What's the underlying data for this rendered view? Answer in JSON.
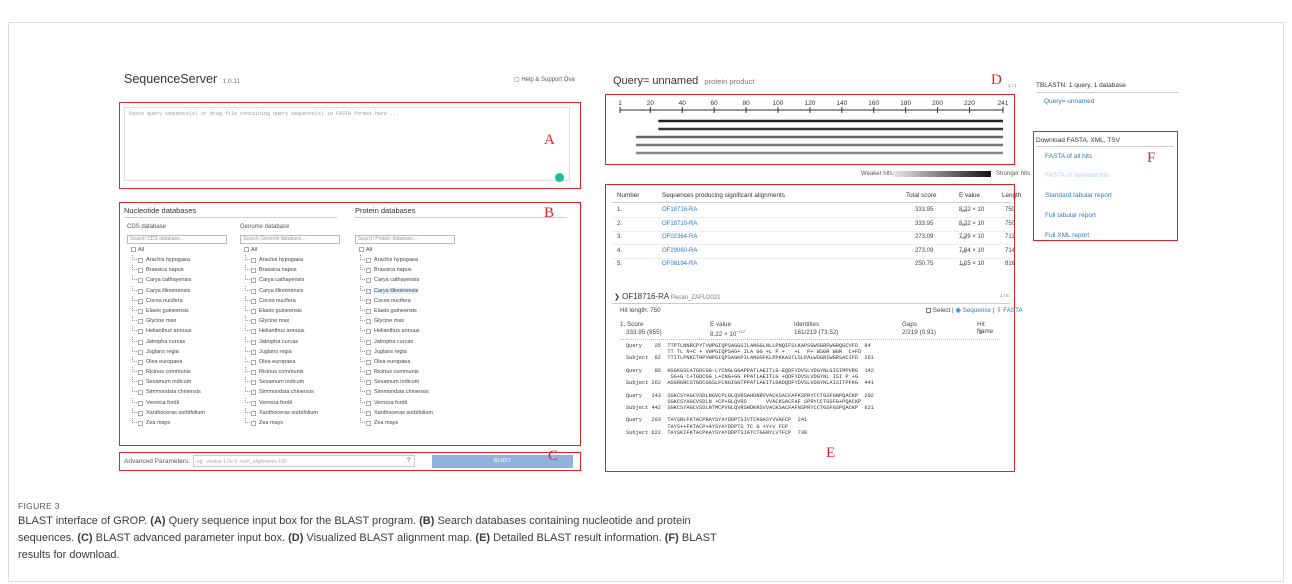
{
  "app": {
    "name": "SequenceServer",
    "version": "1.0.11",
    "help": "Help & Support Ova"
  },
  "query_input": {
    "placeholder": "Paste query sequence(s) or drag file containing query sequence(s) in FASTA format here ..."
  },
  "databases": {
    "nucleotide_title": "Nucleotide databases",
    "protein_title": "Protein databases",
    "cds_title": "CDS database",
    "genome_title": "Genome database",
    "cds_search": "Search CDS database...",
    "genome_search": "Search Genome database...",
    "protein_search": "Search Protein database...",
    "all_label": "All",
    "species": [
      "Arachis hypogaea",
      "Brassica napus",
      "Carya cathayensis",
      "Carya illinoinensis",
      "Cocos nucifera",
      "Elaeis guineensis",
      "Glycine max",
      "Helianthus annuus",
      "Jatropha curcas",
      "Juglans regia",
      "Olea europaea",
      "Ricinus communis",
      "Sesamum indicum",
      "Simmondsia chinensis",
      "Vernicia fordii",
      "Xanthoceras sorbifolium",
      "Zea mays"
    ],
    "highlighted_protein": "Carya illinoinensis"
  },
  "advanced": {
    "label": "Advanced Parameters:",
    "placeholder": "eg: -evalue 1.0e-5 -num_alignments 100",
    "blast_button": "BLAST"
  },
  "query": {
    "title": "Query= unnamed",
    "subtitle": "protein product",
    "counter": "1 / 1",
    "ticks": [
      "1",
      "20",
      "40",
      "60",
      "80",
      "100",
      "120",
      "140",
      "160",
      "180",
      "200",
      "220",
      "241"
    ],
    "weaker": "Weaker hits",
    "stronger": "Stronger hits"
  },
  "results_table": {
    "headers": [
      "Number",
      "Sequences producing significant alignments",
      "Total score",
      "E value",
      "Length"
    ],
    "rows": [
      {
        "n": "1.",
        "id": "OF18716-RA",
        "score": "333.95",
        "e": "8.22 × 10",
        "exp": "−117",
        "len": "750"
      },
      {
        "n": "2.",
        "id": "OF18710-RA",
        "score": "333.95",
        "e": "8.22 × 10",
        "exp": "−117",
        "len": "750"
      },
      {
        "n": "3.",
        "id": "OF02364-RA",
        "score": "273.09",
        "e": "7.39 × 10",
        "exp": "−93",
        "len": "711"
      },
      {
        "n": "4.",
        "id": "OF29060-RA",
        "score": "273.09",
        "e": "7.64 × 10",
        "exp": "−93",
        "len": "714"
      },
      {
        "n": "5.",
        "id": "OF08194-RA",
        "score": "250.75",
        "e": "1.05 × 10",
        "exp": "−83",
        "len": "816"
      }
    ]
  },
  "hit": {
    "title": "OF18716-RA",
    "db": "Pecan_ZAFU2021",
    "counter": "1 / 5",
    "hit_length": "Hit length: 750",
    "select": "Select",
    "sequence": "Sequence",
    "fasta": "FASTA",
    "col_score": "1. Score",
    "col_evalue": "E value",
    "col_identities": "Identities",
    "col_gaps": "Gaps",
    "col_frame": "Hit frame",
    "score": "333.95 (855)",
    "evalue": "8.22 × 10",
    "evalue_exp": "−117",
    "identities": "161/219 (73.52)",
    "gaps": "2/219 (0.91)",
    "frame": "1",
    "alignment": [
      "Query    25  TTPTLNNRCPYTVWPGIQPSAGGSILANGGLNLLPNQIFSLKAPSGWSGRFWGRQGCVFD  84",
      "             TT TL N+C + VWPGIQPSAG+ ILA GG +L P +   +L  P+ WSGR WGR  C+FD",
      "Subject  82  TTITLPNKCTHPVWPGIQPSAGKPILANGGFKLPPKKASTLSLPALWSGRIWGRSACIFD  261",
      "",
      "Query    85  HSGKGSCATGDCGG-LYCNGLGGAPPATLAEITLG-EQDFYDVSLVDGYNLGISIMPVRG  142",
      "              SG+G C+TGDCGG L+CNG+GG PPATLAEITLG +QDFYDVSLVDGYNL ISI P +G",
      "Subject 262  ASGRGRCSTGDCGGSLFCNGIGGTPPATLAEITLGKDQDFYDVSLVDGYNLAISITPFKG  441",
      "",
      "Query   143  SGKCSYAGCVSDLNGVCPLGLQVRSAHDNRVVACKSACFAFKSPRYCCTGSFGNPQACKP  202",
      "             SGKCSYAGCVSDLN +CP+GLQVRS      VVACKSACFAF SPRYCCTGSFG+PQACKP",
      "Subject 442  SGKCSYAGCVSDLNTMCPVGLQVRSHDKRSVVACKSACFAFNSPRYCCTGSFGSPQACKP  621",
      "",
      "Query   203  TAYSRLFKTACPRAYSYAYDDPTSIVTCKGASYVVAFCP  241",
      "             TAYS++FKTACP+AYSYAYDDPTS TC G +Y+V FCP",
      "Subject 622  TAYSKIFKTACPKAYSYAYDDPTSIATCTGGNYLVTFCP  738"
    ]
  },
  "sidebar": {
    "summary": "TBLASTN: 1 query, 1 database",
    "query_link": "Query= unnamed",
    "download_title": "Download FASTA, XML, TSV",
    "downloads": [
      "FASTA of all hits",
      "FASTA of selected hits",
      "Standard tabular report",
      "Full tabular report",
      "Full XML report"
    ]
  },
  "labels": {
    "A": "A",
    "B": "B",
    "C": "C",
    "D": "D",
    "E": "E",
    "F": "F"
  },
  "caption": {
    "figure": "FIGURE 3",
    "line1_a": "BLAST interface of GROP. ",
    "A": "(A)",
    "line1_b": " Query sequence input box for the BLAST program. ",
    "B": "(B)",
    "line1_c": " Search databases containing nucleotide and protein",
    "line2_a": "sequences. ",
    "C": "(C)",
    "line2_b": " BLAST advanced parameter input box. ",
    "D": "(D)",
    "line2_c": " Visualized BLAST alignment map. ",
    "E": "(E)",
    "line2_d": " Detailed BLAST result information. ",
    "F": "(F)",
    "line2_e": " BLAST",
    "line3": "results for download."
  },
  "colors": {
    "red": "#e0232a",
    "link": "#2a7bc0",
    "blast_btn": "#8fb3dc"
  }
}
